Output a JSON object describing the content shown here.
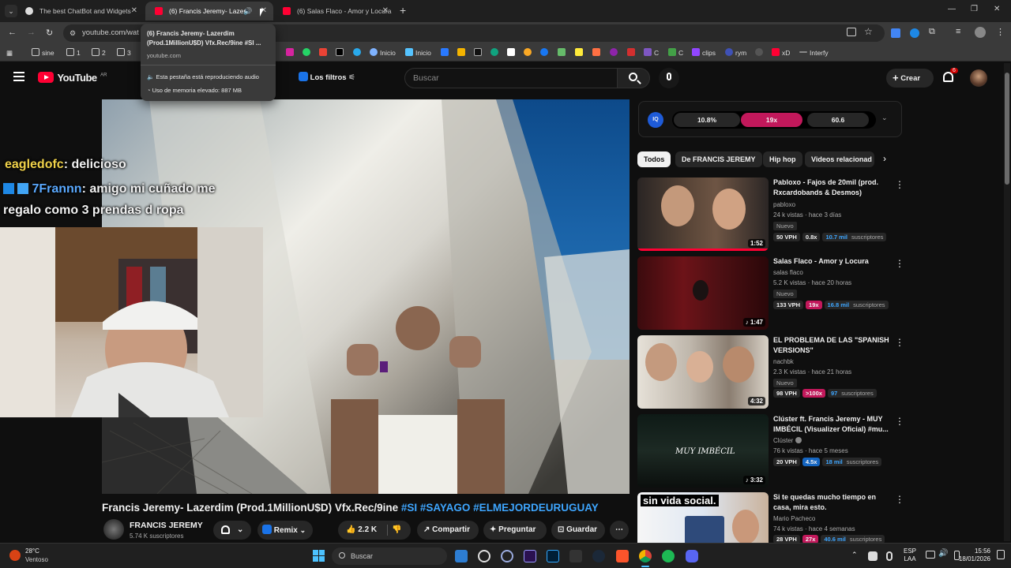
{
  "browser": {
    "tabs": [
      {
        "title": "The best ChatBot and Widgets"
      },
      {
        "title": "(6) Francis Jeremy- Lazerdim"
      },
      {
        "title": "(6) Salas Flaco - Amor y Locura"
      }
    ],
    "url": "youtube.com/wat",
    "bookmarks": [
      "sine",
      "1",
      "2",
      "3",
      "Inicio",
      "Inicio",
      "clips",
      "rym",
      "xD",
      "Interfy"
    ],
    "tooltip": {
      "title": "(6) Francis Jeremy- Lazerdim (Prod.1MillionU$D) Vfx.Rec/9ine #SI ...",
      "domain": "youtube.com",
      "audio": "Esta pestaña está reproduciendo audio",
      "memory": "Uso de memoria elevado: 887 MB"
    }
  },
  "youtube": {
    "logo_text": "YouTube",
    "region": "AR",
    "filters_label": "Los filtros",
    "search_placeholder": "Buscar",
    "create_label": "Crear",
    "notif_count": "6"
  },
  "overlay": {
    "chat": [
      {
        "user": "eagledofc",
        "text": ": delicioso"
      },
      {
        "user": "7Frannn",
        "text": ": amigo mi cuñado me"
      },
      {
        "user": "",
        "text": "regalo como 3 prendas d ropa"
      }
    ]
  },
  "stats_bar": {
    "values": [
      "10.8%",
      "19x",
      "60.6"
    ]
  },
  "chips": [
    "Todos",
    "De FRANCIS JEREMY",
    "Hip hop",
    "Videos relacionad"
  ],
  "recommendations": [
    {
      "title": "Pabloxo - Fajos de 20mil (prod. Rxcardobands & Desmos)",
      "channel": "pabloxo",
      "meta": "24 k vistas · hace 3 días",
      "badge": "Nuevo",
      "duration": "1:52",
      "vph": "50 VPH",
      "mult": "0.8x",
      "subs_num": "10.7 mil",
      "subs_label": "suscriptores",
      "mult_color": "#272727"
    },
    {
      "title": "Salas Flaco - Amor y Locura",
      "channel": "salas flaco",
      "meta": "5.2 K vistas · hace 20 horas",
      "badge": "Nuevo",
      "duration": "1:47",
      "vph": "133 VPH",
      "mult": "19x",
      "subs_num": "16.8 mil",
      "subs_label": "suscriptores",
      "mult_color": "#c2185b"
    },
    {
      "title": "EL PROBLEMA DE LAS \"SPANISH VERSIONS\"",
      "channel": "nachbk",
      "meta": "2.3 K vistas · hace 21 horas",
      "badge": "Nuevo",
      "duration": "4:32",
      "vph": "98 VPH",
      "mult": ">100x",
      "subs_num": "97",
      "subs_label": "suscriptores",
      "mult_color": "#c2185b"
    },
    {
      "title": "Clúster ft. Francis Jeremy - MUY IMBÉCIL (Visualizer Oficial) #mu...",
      "channel": "Clúster",
      "meta": "76 k vistas · hace 5 meses",
      "badge": "",
      "duration": "3:32",
      "vph": "20 VPH",
      "mult": "4.5x",
      "subs_num": "18 mil",
      "subs_label": "suscriptores",
      "mult_color": "#1565c0",
      "thumb_text": "MUY IMBÉCIL"
    },
    {
      "title": "Si te quedas mucho tiempo en casa, mira esto.",
      "channel": "Mario Pacheco",
      "meta": "74 k vistas · hace 4 semanas",
      "badge": "",
      "duration": "",
      "vph": "28 VPH",
      "mult": "27x",
      "subs_num": "40.6 mil",
      "subs_label": "suscriptores",
      "mult_color": "#c2185b",
      "thumb_text": "sin vida social."
    }
  ],
  "video": {
    "title_plain": "Francis Jeremy- Lazerdim (Prod.1MillionU$D) Vfx.Rec/9ine ",
    "hashtags": "#SI #SAYAGO #ELMEJORDEURUGUAY",
    "channel": "FRANCIS JEREMY",
    "subs": "5.74 K suscriptores",
    "remix": "Remix",
    "likes": "2.2 K",
    "share": "Compartir",
    "ask": "Preguntar",
    "save": "Guardar"
  },
  "taskbar": {
    "temp": "28°C",
    "weather": "Ventoso",
    "search": "Buscar",
    "lang1": "ESP",
    "lang2": "LAA",
    "time": "15:56",
    "date": "18/01/2026"
  },
  "colors": {
    "accent_red": "#ff0033",
    "pink": "#c2185b",
    "link_blue": "#3ea6ff"
  }
}
